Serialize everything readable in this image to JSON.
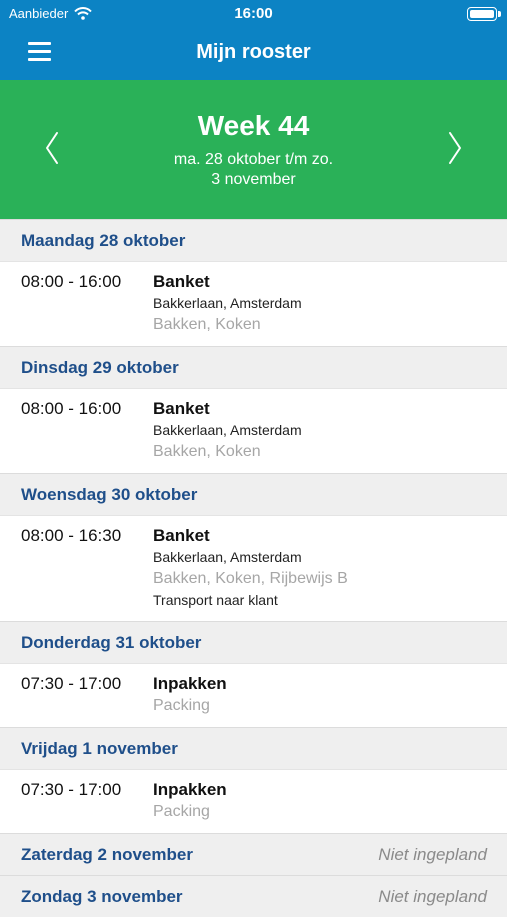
{
  "status_bar": {
    "carrier": "Aanbieder",
    "time": "16:00"
  },
  "nav": {
    "title": "Mijn rooster",
    "menu_icon": "hamburger-menu-icon"
  },
  "week": {
    "title": "Week 44",
    "range_line1": "ma. 28 oktober t/m zo.",
    "range_line2": "3 november",
    "prev_icon": "chevron-left-icon",
    "next_icon": "chevron-right-icon"
  },
  "colors": {
    "nav": "#0c83c4",
    "week_header": "#2ab158",
    "day_label": "#1f4f8a",
    "skills": "#a6a6a6"
  },
  "days": [
    {
      "label": "Maandag 28 oktober",
      "status": "",
      "shifts": [
        {
          "time": "08:00 - 16:00",
          "name": "Banket",
          "location": "Bakkerlaan, Amsterdam",
          "skills": "Bakken, Koken",
          "note": ""
        }
      ]
    },
    {
      "label": "Dinsdag 29 oktober",
      "status": "",
      "shifts": [
        {
          "time": "08:00 - 16:00",
          "name": "Banket",
          "location": "Bakkerlaan, Amsterdam",
          "skills": "Bakken, Koken",
          "note": ""
        }
      ]
    },
    {
      "label": "Woensdag 30 oktober",
      "status": "",
      "shifts": [
        {
          "time": "08:00 - 16:30",
          "name": "Banket",
          "location": "Bakkerlaan, Amsterdam",
          "skills": "Bakken, Koken, Rijbewijs B",
          "note": "Transport naar klant"
        }
      ]
    },
    {
      "label": "Donderdag 31 oktober",
      "status": "",
      "shifts": [
        {
          "time": "07:30 - 17:00",
          "name": "Inpakken",
          "location": "",
          "skills": "Packing",
          "note": ""
        }
      ]
    },
    {
      "label": "Vrijdag 1 november",
      "status": "",
      "shifts": [
        {
          "time": "07:30 - 17:00",
          "name": "Inpakken",
          "location": "",
          "skills": "Packing",
          "note": ""
        }
      ]
    },
    {
      "label": "Zaterdag 2 november",
      "status": "Niet ingepland",
      "shifts": []
    },
    {
      "label": "Zondag 3 november",
      "status": "Niet ingepland",
      "shifts": []
    }
  ]
}
